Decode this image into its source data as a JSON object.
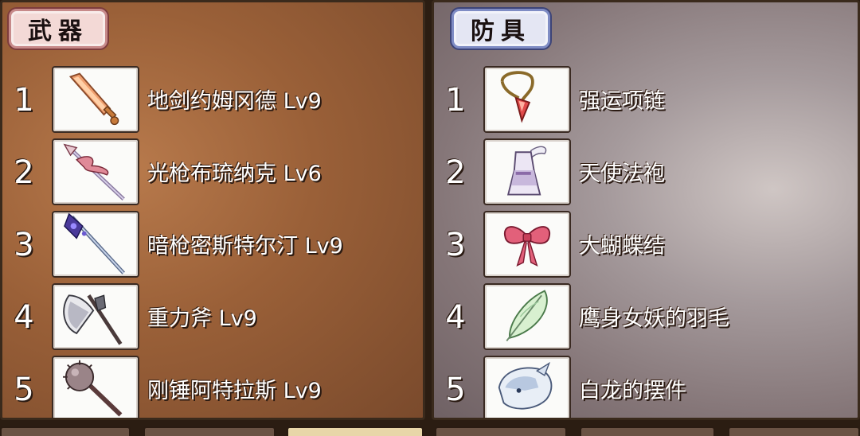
{
  "weapons": {
    "title": "武器",
    "items": [
      {
        "num": "1",
        "name": "地剑约姆冈德 Lv9",
        "icon": "sword-icon"
      },
      {
        "num": "2",
        "name": "光枪布琉纳克 Lv6",
        "icon": "light-spear-icon"
      },
      {
        "num": "3",
        "name": "暗枪密斯特尔汀 Lv9",
        "icon": "dark-spear-icon"
      },
      {
        "num": "4",
        "name": "重力斧 Lv9",
        "icon": "axe-icon"
      },
      {
        "num": "5",
        "name": "刚锤阿特拉斯 Lv9",
        "icon": "mace-icon"
      }
    ]
  },
  "armor": {
    "title": "防具",
    "items": [
      {
        "num": "1",
        "name": "强运项链",
        "icon": "necklace-icon"
      },
      {
        "num": "2",
        "name": "天使法袍",
        "icon": "angel-robe-icon"
      },
      {
        "num": "3",
        "name": "大蝴蝶结",
        "icon": "ribbon-icon"
      },
      {
        "num": "4",
        "name": "鹰身女妖的羽毛",
        "icon": "feather-icon"
      },
      {
        "num": "5",
        "name": "白龙的摆件",
        "icon": "white-dragon-icon"
      }
    ]
  },
  "colors": {
    "weapons_bg": "#9a6038",
    "armor_bg": "#a59a9c",
    "weapons_tag_border": "#c78a8a",
    "armor_tag_border": "#7f8cc4"
  }
}
